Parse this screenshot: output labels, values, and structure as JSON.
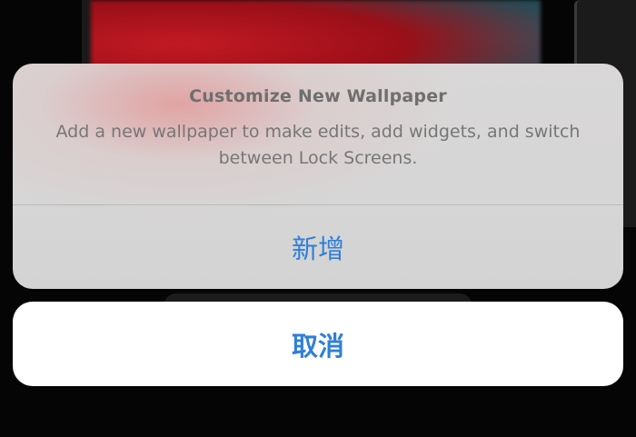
{
  "action_sheet": {
    "title": "Customize New Wallpaper",
    "message": "Add a new wallpaper to make edits, add widgets, and switch between Lock Screens.",
    "add_label": "新增"
  },
  "cancel": {
    "label": "取消"
  },
  "colors": {
    "accent": "#2f7fd8",
    "sheet_background": "#d6d6d6",
    "title_text": "#6f6f6f",
    "message_text": "#777777",
    "cancel_background": "#ffffff"
  }
}
